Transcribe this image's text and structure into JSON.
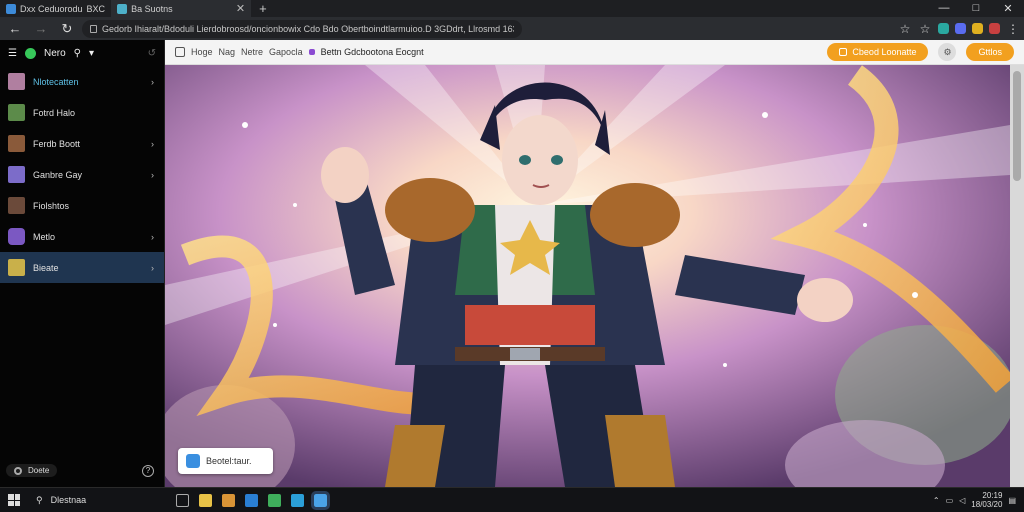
{
  "browser": {
    "tabs": [
      {
        "label": "Dxx Ceduorodu",
        "extra": "BXC"
      },
      {
        "label": "Ba Suotns"
      }
    ],
    "url": "Gedorb Ihiaralt/Bdoduli Lierdobroosd/oncionbowix Cdo Bdo Obertboindtlarmuioo.D 3GDdrt, Llrosmd 163",
    "window_controls": [
      "—",
      "□",
      "✕"
    ]
  },
  "sidebar": {
    "header_label": "Nero",
    "items": [
      {
        "label": "Nlotecatten",
        "color": "#b07fa0"
      },
      {
        "label": "Fotrd Halo",
        "color": "#5c8b4a"
      },
      {
        "label": "Ferdb Boott",
        "color": "#8a5a3a"
      },
      {
        "label": "Ganbre Gay",
        "color": "#7c6cc9"
      },
      {
        "label": "Fiolshtos",
        "color": "#6b4a3a"
      },
      {
        "label": "Metlo",
        "color": "#7b58c2"
      },
      {
        "label": "Bieate",
        "color": "#c9b04a"
      }
    ],
    "footer_label": "Doete"
  },
  "content_toolbar": {
    "crumbs": [
      "Hoge",
      "Nag",
      "Netre",
      "Gapocla"
    ],
    "title": "Bettn Gdcbootona Eocgnt",
    "primary_button": "Cbeod Loonatte",
    "secondary_button": "Gttlos"
  },
  "artwork": {
    "description_label": "",
    "toast_label": "Beotel:taur."
  },
  "taskbar": {
    "search_label": "Dlestnaa",
    "time": "20:19",
    "date": "18/03/20"
  }
}
